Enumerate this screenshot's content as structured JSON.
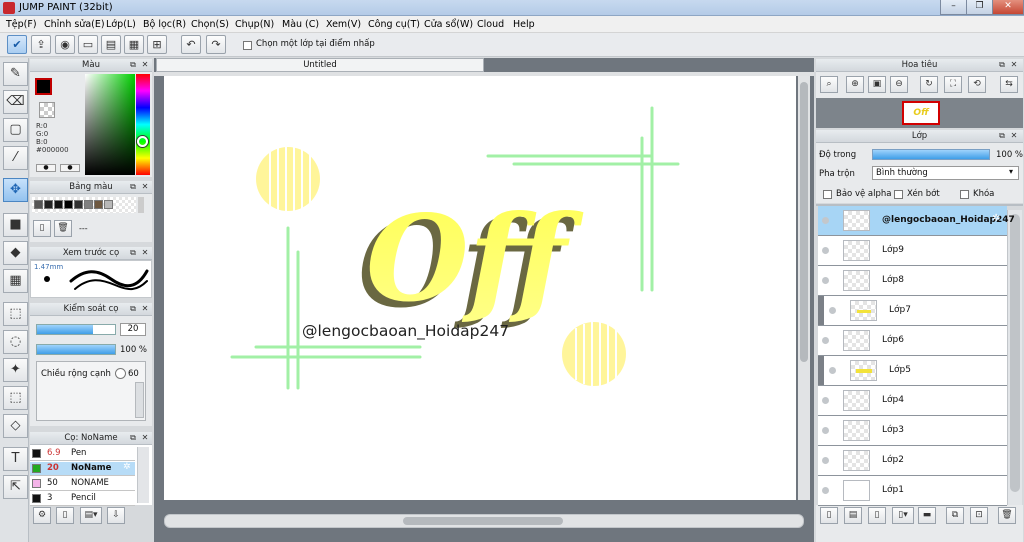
{
  "app": {
    "title": "JUMP PAINT (32bit)"
  },
  "menu": [
    "Tệp(F)",
    "Chỉnh sửa(E)",
    "Lớp(L)",
    "Bộ lọc(R)",
    "Chọn(S)",
    "Chụp(N)",
    "Màu (C)",
    "Xem(V)",
    "Công cụ(T)",
    "Cửa sổ(W)",
    "Cloud",
    "Help"
  ],
  "toolbar": {
    "select_layer_label": "Chọn một lớp tại điểm nhấp"
  },
  "color_panel": {
    "title": "Màu",
    "r": "R:0",
    "g": "G:0",
    "b": "B:0",
    "hex": "#000000",
    "colors": {
      "fg": "#000000",
      "bg": "#ffffff"
    }
  },
  "palette_panel": {
    "title": "Bảng màu",
    "colors": [
      "#555555",
      "#222222",
      "#111111",
      "#000000",
      "#303030",
      "#808080",
      "#6e5840",
      "#b8b8b8"
    ],
    "more_label": "---"
  },
  "brush_preview": {
    "title": "Xem trước cọ",
    "size": "1.47mm"
  },
  "brush_control": {
    "title": "Kiểm soát cọ",
    "size_value": "20",
    "opacity_value": "100 %",
    "edge_label": "Chiều rộng cạnh",
    "edge_value": "60",
    "size_fill": 0.72,
    "opacity_fill": 1.0
  },
  "brush_list": {
    "title": "Cọ: NoName",
    "items": [
      {
        "size": "6.9",
        "name": "Pen",
        "color": "#111111"
      },
      {
        "size": "20",
        "name": "NoName",
        "color": "#22aa22"
      },
      {
        "size": "50",
        "name": "NONAME",
        "color": "#f4b3e8"
      },
      {
        "size": "3",
        "name": "Pencil",
        "color": "#111111"
      }
    ]
  },
  "canvas": {
    "tab_title": "Untitled",
    "watermark": "@lengocbaoan_Hoidap247",
    "art_text": "Off"
  },
  "navigator": {
    "title": "Hoa tiêu",
    "thumb_text": "Off"
  },
  "layers_panel": {
    "title": "Lớp",
    "opacity_label": "Độ trong",
    "opacity_value": "100 %",
    "opacity_fill": 1.0,
    "blend_label": "Pha trộn",
    "blend_value": "Bình thường",
    "protect_alpha": "Bảo vệ alpha",
    "clip": "Xén bớt",
    "lock": "Khóa",
    "layers": [
      {
        "name": "@lengocbaoan_Hoidap247",
        "selected": true,
        "clipped": false
      },
      {
        "name": "Lớp9",
        "selected": false,
        "clipped": false
      },
      {
        "name": "Lớp8",
        "selected": false,
        "clipped": false
      },
      {
        "name": "Lớp7",
        "selected": false,
        "clipped": true
      },
      {
        "name": "Lớp6",
        "selected": false,
        "clipped": false
      },
      {
        "name": "Lớp5",
        "selected": false,
        "clipped": true
      },
      {
        "name": "Lớp4",
        "selected": false,
        "clipped": false
      },
      {
        "name": "Lớp3",
        "selected": false,
        "clipped": false
      },
      {
        "name": "Lớp2",
        "selected": false,
        "clipped": false
      },
      {
        "name": "Lớp1",
        "selected": false,
        "clipped": false
      }
    ]
  },
  "art_colors": {
    "yellow": "#ffef3a",
    "pale_yellow": "#fff38a",
    "green": "#9cf2a0",
    "olive": "#6c6a44",
    "accent": "#56b4ea"
  }
}
